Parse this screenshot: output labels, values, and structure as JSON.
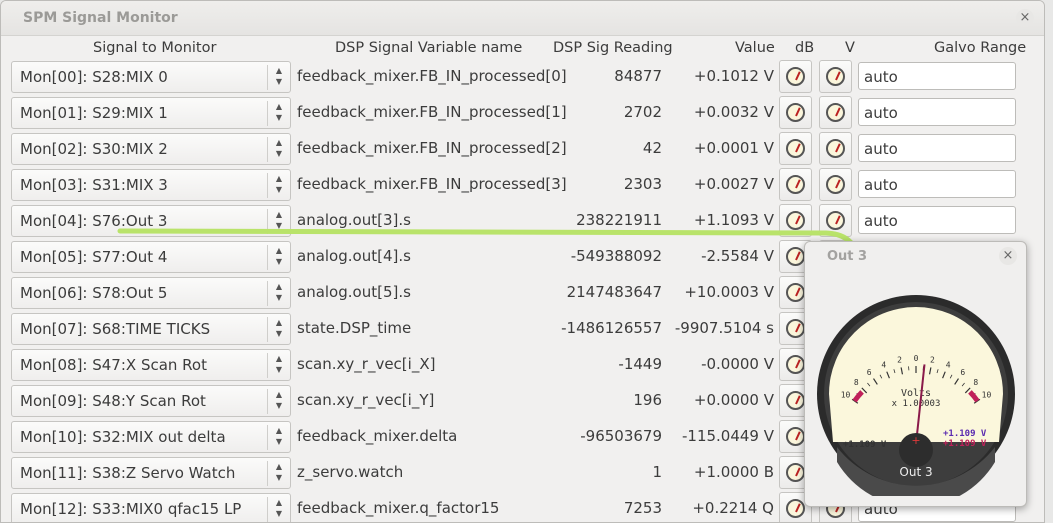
{
  "window": {
    "title": "SPM Signal Monitor",
    "close_label": "×"
  },
  "headers": {
    "signal": "Signal to Monitor",
    "varname": "DSP Signal Variable name",
    "reading": "DSP Sig Reading",
    "value": "Value",
    "db": "dB",
    "v": "V",
    "galvo": "Galvo Range"
  },
  "rows": [
    {
      "signal": "Mon[00]: S28:MIX 0",
      "var": "feedback_mixer.FB_IN_processed[0]",
      "reading": "84877",
      "value": "+0.1012 V",
      "galvo": "auto"
    },
    {
      "signal": "Mon[01]: S29:MIX 1",
      "var": "feedback_mixer.FB_IN_processed[1]",
      "reading": "2702",
      "value": "+0.0032 V",
      "galvo": "auto"
    },
    {
      "signal": "Mon[02]: S30:MIX 2",
      "var": "feedback_mixer.FB_IN_processed[2]",
      "reading": "42",
      "value": "+0.0001 V",
      "galvo": "auto"
    },
    {
      "signal": "Mon[03]: S31:MIX 3",
      "var": "feedback_mixer.FB_IN_processed[3]",
      "reading": "2303",
      "value": "+0.0027 V",
      "galvo": "auto"
    },
    {
      "signal": "Mon[04]: S76:Out 3",
      "var": "analog.out[3].s",
      "reading": "238221911",
      "value": "+1.1093 V",
      "galvo": "auto"
    },
    {
      "signal": "Mon[05]: S77:Out 4",
      "var": "analog.out[4].s",
      "reading": "-549388092",
      "value": "-2.5584 V",
      "galvo": ""
    },
    {
      "signal": "Mon[06]: S78:Out 5",
      "var": "analog.out[5].s",
      "reading": "2147483647",
      "value": "+10.0003 V",
      "galvo": ""
    },
    {
      "signal": "Mon[07]: S68:TIME TICKS",
      "var": "state.DSP_time",
      "reading": "-1486126557",
      "value": "-9907.5104 s",
      "galvo": ""
    },
    {
      "signal": "Mon[08]: S47:X Scan Rot",
      "var": "scan.xy_r_vec[i_X]",
      "reading": "-1449",
      "value": "-0.0000 V",
      "galvo": ""
    },
    {
      "signal": "Mon[09]: S48:Y Scan Rot",
      "var": "scan.xy_r_vec[i_Y]",
      "reading": "196",
      "value": "+0.0000 V",
      "galvo": ""
    },
    {
      "signal": "Mon[10]: S32:MIX out delta",
      "var": "feedback_mixer.delta",
      "reading": "-96503679",
      "value": "-115.0449 V",
      "galvo": ""
    },
    {
      "signal": "Mon[11]: S38:Z Servo Watch",
      "var": "z_servo.watch",
      "reading": "1",
      "value": "+1.0000 B",
      "galvo": ""
    },
    {
      "signal": "Mon[12]: S33:MIX0 qfac15 LP",
      "var": "feedback_mixer.q_factor15",
      "reading": "7253",
      "value": "+0.2214 Q",
      "galvo": "auto"
    }
  ],
  "popup": {
    "title": "Out 3",
    "close_label": "×",
    "meter": {
      "scale_labels": [
        "10",
        "8",
        "6",
        "4",
        "2",
        "0",
        "2",
        "4",
        "6",
        "8",
        "10"
      ],
      "label": "Volts",
      "multiplier": "x 1.00003",
      "left_readout": "+1.109 V",
      "right_readout_1": "+1.109 V",
      "right_readout_2": "+1.109 V",
      "hub_mark": "+",
      "name": "Out 3",
      "needle_value": 1.109,
      "scale_max": 10
    }
  },
  "colors": {
    "accent_arrow": "#b9e36a",
    "needle": "#8a1a4a",
    "readout_blue": "#5a2ab0",
    "readout_red": "#c0205a",
    "scale_red": "#c0205a"
  }
}
